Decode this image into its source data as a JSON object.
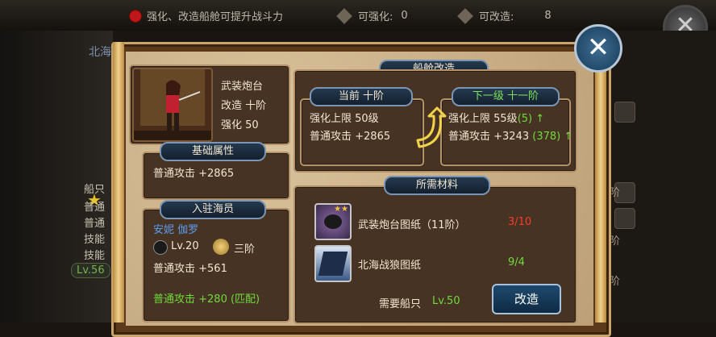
{
  "background": {
    "tip": "强化、改造船舱可提升战斗力",
    "can_enhance_label": "可强化:",
    "can_enhance_value": "0",
    "can_modify_label": "可改造:",
    "can_modify_value": "8",
    "left_rows": [
      "船只",
      "普通",
      "普通",
      "技能",
      "技能"
    ],
    "north_label": "北海",
    "lv": "Lv.56",
    "right_texts": [
      "阶",
      "阶",
      "阶"
    ]
  },
  "modal": {
    "title": "船舱改造",
    "unit": {
      "name": "武装炮台",
      "modify": "改造  十阶",
      "enhance": "强化  50"
    },
    "base_attr": {
      "title": "基础属性",
      "attack": "普通攻击 +2865"
    },
    "crew": {
      "title": "入驻海员",
      "name": "安妮  伽罗",
      "level": "Lv.20",
      "rank": "三阶",
      "attack": "普通攻击 +561",
      "match_attack": "普通攻击 +280 (匹配)"
    },
    "current": {
      "title": "当前  十阶",
      "limit": "强化上限 50级",
      "attack": "普通攻击 +2865"
    },
    "next": {
      "title": "下一级  十一阶",
      "limit": "强化上限 55级",
      "limit_delta": "(5)",
      "attack": "普通攻击 +3243",
      "attack_delta": "(378)",
      "up_arrow": "↑"
    },
    "materials": {
      "title": "所需材料",
      "items": [
        {
          "name": "武装炮台图纸（11阶）",
          "count": "3/10"
        },
        {
          "name": "北海战狼图纸",
          "count": "9/4"
        }
      ]
    },
    "required_ship_label": "需要船只",
    "required_ship_level": "Lv.50",
    "modify_button": "改造"
  },
  "colors": {
    "green": "#6fdb3c",
    "red": "#ff3a2a",
    "tag_blue": "#24394f",
    "frame_gold": "#caa36a"
  }
}
